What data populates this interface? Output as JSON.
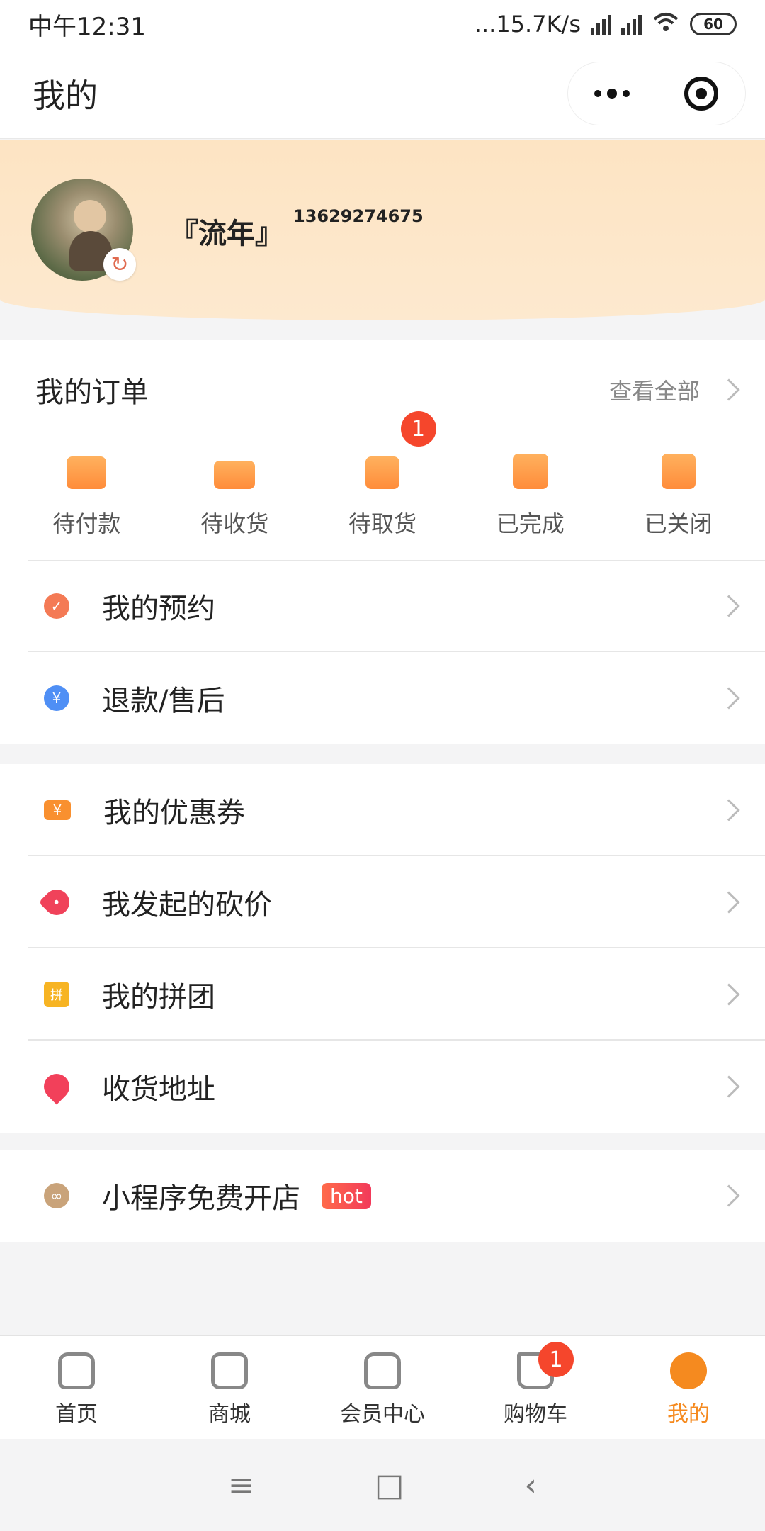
{
  "status": {
    "time": "中午12:31",
    "net": "...15.7K/s",
    "battery": "60"
  },
  "header": {
    "title": "我的"
  },
  "profile": {
    "name": "『流年』",
    "phone": "13629274675"
  },
  "orders": {
    "title": "我的订单",
    "view_all": "查看全部",
    "items": [
      {
        "label": "待付款",
        "icon": "wallet-icon"
      },
      {
        "label": "待收货",
        "icon": "truck-icon"
      },
      {
        "label": "待取货",
        "icon": "box-icon",
        "badge": "1"
      },
      {
        "label": "已完成",
        "icon": "clipboard-check-icon"
      },
      {
        "label": "已关闭",
        "icon": "doc-closed-icon"
      }
    ]
  },
  "menu1": [
    {
      "label": "我的预约",
      "icon": "check-circle-icon",
      "color": "#f47a55"
    },
    {
      "label": "退款/售后",
      "icon": "refund-icon",
      "color": "#4f8ff5"
    }
  ],
  "menu2": [
    {
      "label": "我的优惠券",
      "icon": "coupon-icon",
      "color": "#f9902f"
    },
    {
      "label": "我发起的砍价",
      "icon": "tag-icon",
      "color": "#f0425a"
    },
    {
      "label": "我的拼团",
      "icon": "group-icon",
      "color": "#f7b423"
    },
    {
      "label": "收货地址",
      "icon": "location-icon",
      "color": "#f2405a"
    }
  ],
  "menu3": [
    {
      "label": "小程序免费开店",
      "icon": "link-icon",
      "color": "#c9a37a",
      "tag": "hot"
    }
  ],
  "tabbar": [
    {
      "label": "首页",
      "icon": "home-icon"
    },
    {
      "label": "商城",
      "icon": "bag-icon"
    },
    {
      "label": "会员中心",
      "icon": "member-icon"
    },
    {
      "label": "购物车",
      "icon": "cart-icon",
      "badge": "1"
    },
    {
      "label": "我的",
      "icon": "profile-face-icon",
      "active": true
    }
  ],
  "colors": {
    "accent": "#f58a1f",
    "badge": "#f5462c",
    "banner": "#fde4c3"
  }
}
